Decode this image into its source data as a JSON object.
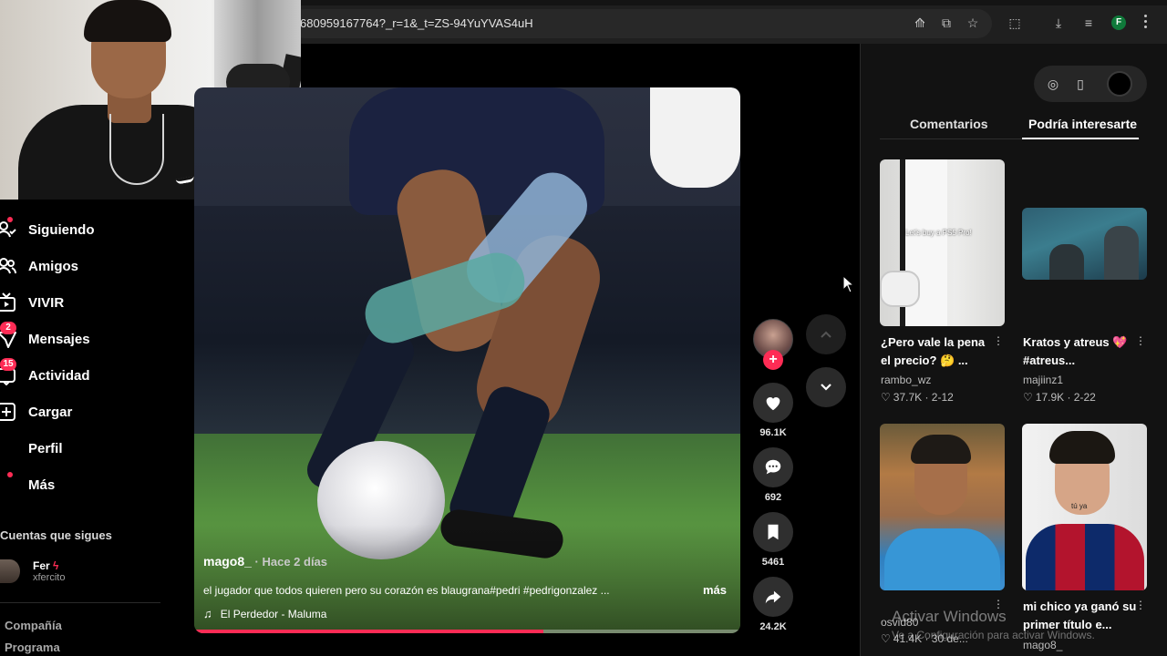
{
  "browser": {
    "url": "680959167764?_r=1&_t=ZS-94YuYVAS4uH",
    "profile_initial": "F",
    "icons": [
      "translate-icon",
      "install-icon",
      "bookmark-star-icon",
      "extensions-icon",
      "download-icon",
      "media-icon",
      "profile-icon",
      "menu-icon"
    ]
  },
  "sidebar": {
    "items": [
      {
        "label": "Siguiendo",
        "icon": "following-icon",
        "dot": true
      },
      {
        "label": "Amigos",
        "icon": "friends-icon"
      },
      {
        "label": "VIVIR",
        "icon": "live-icon"
      },
      {
        "label": "Mensajes",
        "icon": "messages-icon",
        "badge": "2"
      },
      {
        "label": "Actividad",
        "icon": "activity-icon",
        "badge": "15"
      },
      {
        "label": "Cargar",
        "icon": "upload-icon"
      },
      {
        "label": "Perfil",
        "icon": "profile-icon"
      },
      {
        "label": "Más",
        "icon": "more-icon",
        "dot": true
      }
    ],
    "following_title": "Cuentas que sigues",
    "following": [
      {
        "name": "Fer",
        "handle": "xfercito"
      }
    ],
    "footer": [
      "Compañía",
      "Programa"
    ]
  },
  "video": {
    "author": "mago8_",
    "time": " · Hace 2 días",
    "description": "el jugador que todos quieren pero su corazón es blaugrana#pedri #pedrigonzalez ...",
    "more_label": "más",
    "music": "El Perdedor - Maluma",
    "progress_percent": 64
  },
  "actions": {
    "likes": "96.1K",
    "comments": "692",
    "saves": "5461",
    "shares": "24.2K"
  },
  "panel": {
    "tabs": [
      "Comentarios",
      "Podría interesarte"
    ],
    "active_tab": 1,
    "cards": [
      {
        "title": "¿Pero vale la pena el precio? 🤔 ...",
        "user": "rambo_wz",
        "likes": "37.7K",
        "date": "2-12",
        "caption": "Let's buy a PS5 Pro!"
      },
      {
        "title": "Kratos y atreus 💖 #atreus...",
        "user": "majiinz1",
        "likes": "17.9K",
        "date": "2-22"
      },
      {
        "title": "",
        "user": "osvid80",
        "likes": "41.4K",
        "date": "30 de..."
      },
      {
        "title": "mi chico ya ganó su primer título e...",
        "user": "mago8_",
        "likes": "",
        "date": "",
        "caption": "tú ya"
      }
    ]
  },
  "watermark": {
    "line1": "Activar Windows",
    "line2": "Ve a Configuración para activar Windows."
  }
}
